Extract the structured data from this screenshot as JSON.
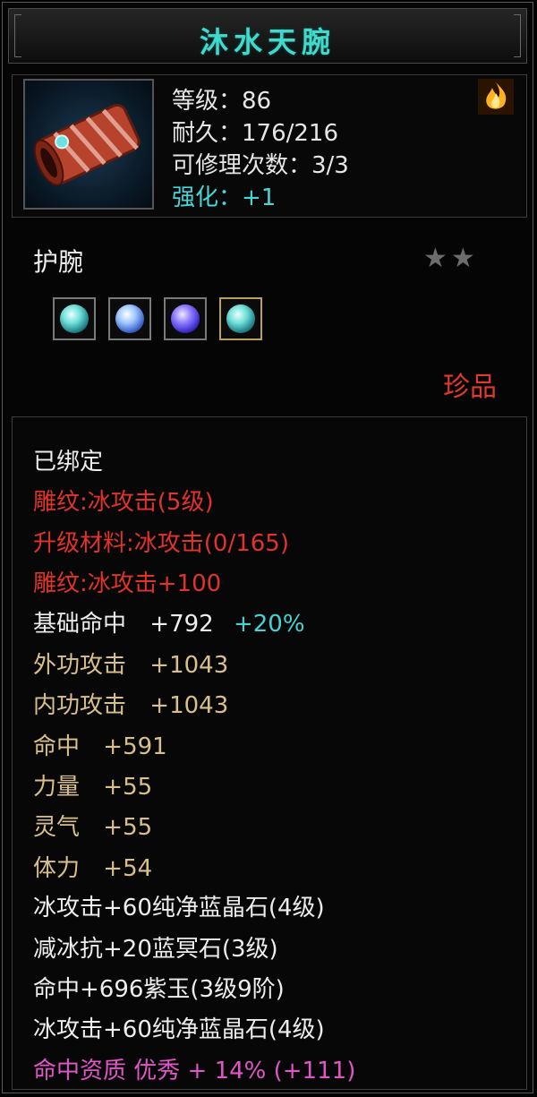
{
  "title": "沐水天腕",
  "header": {
    "icon": "bracer-item-icon",
    "level": "等级：86",
    "durability": "耐久：176/216",
    "repairs": "可修理次数：3/3",
    "enhance": "强化：+1",
    "element_icon": "fire-element-icon"
  },
  "type_label": "护腕",
  "stars": "★★",
  "gems": [
    {
      "icon": "cyan-gem-icon",
      "color": "#6fe0d8"
    },
    {
      "icon": "blue-gem-icon",
      "color": "#9ec6ff"
    },
    {
      "icon": "purple-gem-icon",
      "color": "#8b7bff"
    },
    {
      "icon": "cyan-gem-icon",
      "color": "#6fe0d8"
    }
  ],
  "quality": "珍品",
  "details": {
    "bound": "已绑定",
    "engrave1": "雕纹:冰攻击(5级)",
    "upgrade_material": "升级材料:冰攻击(0/165)",
    "engrave2": "雕纹:冰攻击+100",
    "base_hit": {
      "label": "基础命中",
      "value": "+792",
      "bonus": "+20%"
    },
    "outer_attack": {
      "label": "外功攻击",
      "value": "+1043"
    },
    "inner_attack": {
      "label": "内功攻击",
      "value": "+1043"
    },
    "hit": {
      "label": "命中",
      "value": "+591"
    },
    "strength": {
      "label": "力量",
      "value": "+55"
    },
    "spirit": {
      "label": "灵气",
      "value": "+55"
    },
    "stamina": {
      "label": "体力",
      "value": "+54"
    },
    "gem_line1": "冰攻击+60纯净蓝晶石(4级)",
    "gem_line2": "减冰抗+20蓝冥石(3级)",
    "gem_line3": "命中+696紫玉(3级9阶)",
    "gem_line4": "冰攻击+60纯净蓝晶石(4级)",
    "aptitude": "命中资质 优秀 + 14% (+111)"
  },
  "colors": {
    "title": "#3fd9ce",
    "red": "#e0332a",
    "gold": "#d9c08a",
    "cyan": "#45d2d2",
    "pink": "#e056c6"
  }
}
